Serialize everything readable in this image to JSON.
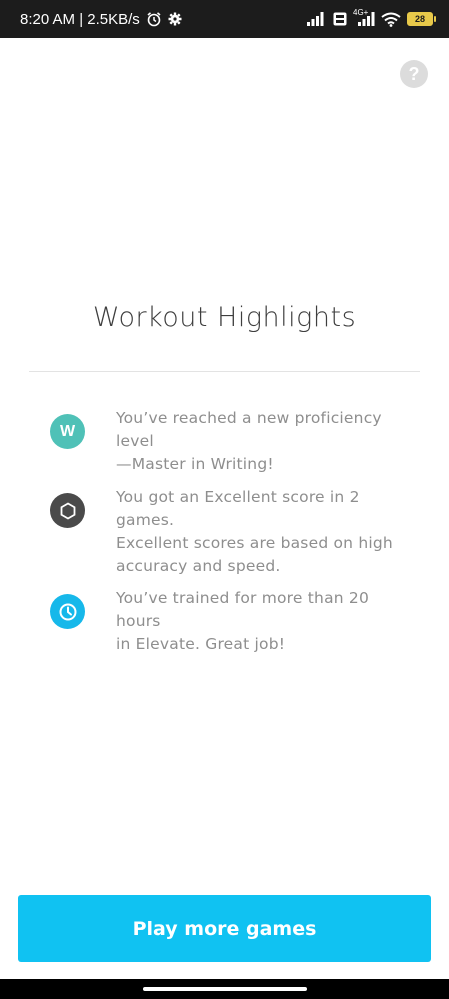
{
  "status_bar": {
    "time_speed": "8:20 AM | 2.5KB/s",
    "network_label": "4G+",
    "battery_level": "28"
  },
  "help": {
    "label": "?"
  },
  "title": "Workout Highlights",
  "highlights": [
    {
      "icon_name": "writing-badge-icon",
      "icon_letter": "W",
      "color": "#4fc1b7",
      "text": "You’ve reached a new proficiency level\n—Master in Writing!"
    },
    {
      "icon_name": "hexagon-score-icon",
      "color": "#4a4a4a",
      "text": "You got an Excellent score in 2 games.\nExcellent scores are based on high\naccuracy and speed."
    },
    {
      "icon_name": "clock-icon",
      "color": "#16b8ea",
      "text": "You’ve trained for more than 20 hours\nin Elevate. Great job!"
    }
  ],
  "cta": {
    "label": "Play more games",
    "color": "#10c2f2"
  }
}
